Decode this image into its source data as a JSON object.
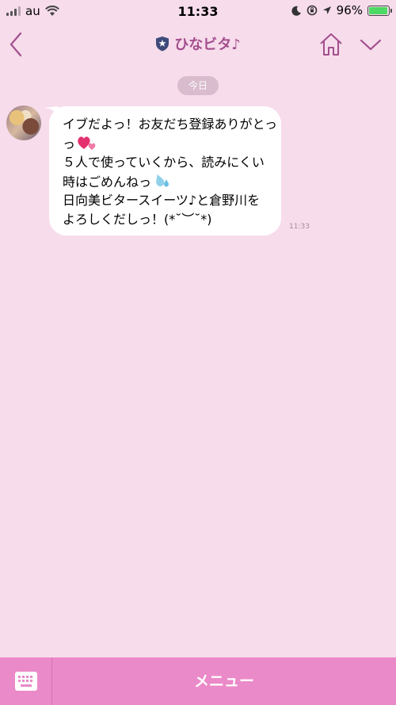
{
  "status_bar": {
    "carrier": "au",
    "time": "11:33",
    "battery_percent": "96%",
    "battery_level": 0.96
  },
  "header": {
    "title": "ひなビタ♪",
    "icons": [
      "back-chevron-icon",
      "shield-star-icon",
      "home-icon",
      "chevron-down-icon"
    ]
  },
  "chat": {
    "date_label": "今日",
    "messages": [
      {
        "lines": [
          "イブだよっ！お友だち登録ありがとっ",
          "っ",
          "５人で使っていくから、読みにくい",
          "時はごめんねっ",
          "日向美ビタースイーツ♪と倉野川を",
          "よろしくだしっ！(*˘︶˘*)"
        ],
        "time": "11:33"
      }
    ]
  },
  "footer": {
    "menu_label": "メニュー",
    "icons": [
      "keyboard-icon"
    ]
  },
  "colors": {
    "background": "#f7dcec",
    "accent": "#a24f8d",
    "footer": "#eb8ac8"
  }
}
